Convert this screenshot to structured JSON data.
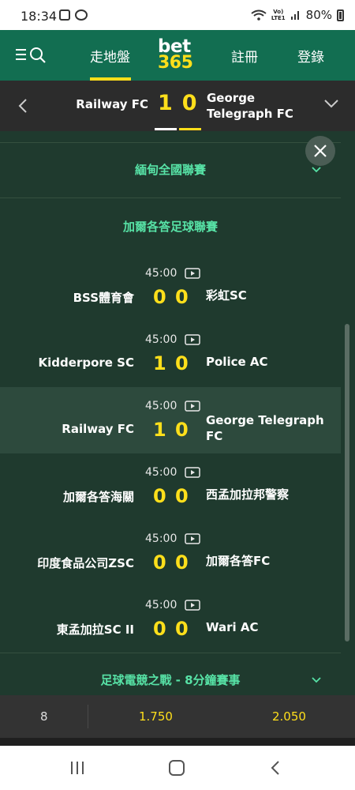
{
  "status_bar": {
    "time": "18:34",
    "lte": "Vo)\nLTE1",
    "battery": "80%"
  },
  "nav": {
    "live": "走地盤",
    "logo_top": "bet",
    "logo_bottom": "365",
    "register": "註冊",
    "login": "登錄"
  },
  "current_match": {
    "home": "Railway FC",
    "home_score": "1",
    "away_score": "0",
    "away": "George Telegraph FC"
  },
  "competitions": [
    {
      "name": "緬甸全國聯賽"
    },
    {
      "name": "加爾各答足球聯賽"
    },
    {
      "name": "足球電競之戰 - 8分鐘賽事"
    }
  ],
  "matches": [
    {
      "time": "45:00",
      "home": "BSS體育會",
      "home_score": "0",
      "away_score": "0",
      "away": "彩虹SC"
    },
    {
      "time": "45:00",
      "home": "Kidderpore SC",
      "home_score": "1",
      "away_score": "0",
      "away": "Police AC"
    },
    {
      "time": "45:00",
      "home": "Railway FC",
      "home_score": "1",
      "away_score": "0",
      "away": "George Telegraph FC"
    },
    {
      "time": "45:00",
      "home": "加爾各答海關",
      "home_score": "0",
      "away_score": "0",
      "away": "西孟加拉邦警察"
    },
    {
      "time": "45:00",
      "home": "印度食品公司ZSC",
      "home_score": "0",
      "away_score": "0",
      "away": "加爾各答FC"
    },
    {
      "time": "45:00",
      "home": "東孟加拉SC II",
      "home_score": "0",
      "away_score": "0",
      "away": "Wari AC"
    }
  ],
  "odds_bar": {
    "count": "8",
    "odd1": "1.750",
    "odd2": "2.050"
  },
  "colors": {
    "header_green": "#126e51",
    "accent_yellow": "#ffdf1b",
    "comp_green": "#57e2a6",
    "bg": "#1f3a2e"
  },
  "icons": [
    "menu-icon",
    "search-icon",
    "back-chevron-icon",
    "dropdown-chevron-icon",
    "close-icon",
    "video-icon",
    "recent-apps-icon",
    "home-icon",
    "back-icon"
  ]
}
